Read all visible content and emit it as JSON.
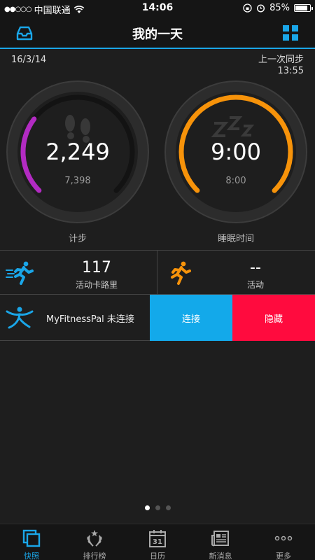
{
  "status_bar": {
    "signal": "●●○○○",
    "carrier": "中国联通",
    "time": "14:06",
    "battery_percent": "85%",
    "battery_level": 0.85
  },
  "nav": {
    "title": "我的一天"
  },
  "date": "16/3/14",
  "sync": {
    "label": "上一次同步",
    "time": "13:55"
  },
  "steps": {
    "value": "2,249",
    "goal": "7,398",
    "label": "计步",
    "progress": 0.304,
    "color": "#b22bc2"
  },
  "sleep": {
    "value": "9:00",
    "goal": "8:00",
    "label": "睡眠时间",
    "progress": 1.0,
    "color": "#f7930a"
  },
  "calories": {
    "value": "117",
    "label": "活动卡路里",
    "icon": "running-person-icon",
    "color": "#1aa6e8"
  },
  "activity": {
    "value": "--",
    "label": "活动",
    "icon": "running-person-icon",
    "color": "#f7930a"
  },
  "myfitnesspal": {
    "text": "MyFitnessPal 未连接",
    "connect_label": "连接",
    "hide_label": "隐藏",
    "connect_color": "#13a9ea",
    "hide_color": "#ff0b3e"
  },
  "pager": {
    "count": 3,
    "active": 0
  },
  "tabs": [
    {
      "label": "快照",
      "icon": "snapshot-icon",
      "active": true
    },
    {
      "label": "排行榜",
      "icon": "laurel-icon",
      "active": false
    },
    {
      "label": "日历",
      "icon": "calendar-icon",
      "active": false,
      "day": "31"
    },
    {
      "label": "新消息",
      "icon": "newspaper-icon",
      "active": false
    },
    {
      "label": "更多",
      "icon": "more-icon",
      "active": false
    }
  ]
}
